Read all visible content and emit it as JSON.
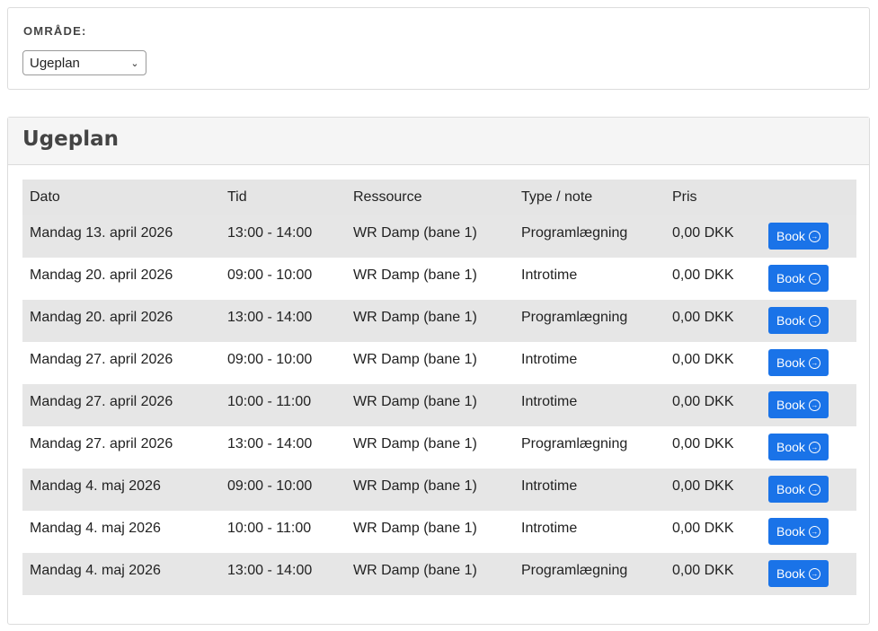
{
  "filter": {
    "label": "OMRÅDE:",
    "selected": "Ugeplan"
  },
  "schedule": {
    "title": "Ugeplan",
    "columns": [
      "Dato",
      "Tid",
      "Ressource",
      "Type / note",
      "Pris",
      ""
    ],
    "book_label": "Book",
    "rows": [
      {
        "date": "Mandag 13. april 2026",
        "time": "13:00 - 14:00",
        "resource": "WR Damp (bane 1)",
        "type": "Programlægning",
        "price": "0,00 DKK"
      },
      {
        "date": "Mandag 20. april 2026",
        "time": "09:00 - 10:00",
        "resource": "WR Damp (bane 1)",
        "type": "Introtime",
        "price": "0,00 DKK"
      },
      {
        "date": "Mandag 20. april 2026",
        "time": "13:00 - 14:00",
        "resource": "WR Damp (bane 1)",
        "type": "Programlægning",
        "price": "0,00 DKK"
      },
      {
        "date": "Mandag 27. april 2026",
        "time": "09:00 - 10:00",
        "resource": "WR Damp (bane 1)",
        "type": "Introtime",
        "price": "0,00 DKK"
      },
      {
        "date": "Mandag 27. april 2026",
        "time": "10:00 - 11:00",
        "resource": "WR Damp (bane 1)",
        "type": "Introtime",
        "price": "0,00 DKK"
      },
      {
        "date": "Mandag 27. april 2026",
        "time": "13:00 - 14:00",
        "resource": "WR Damp (bane 1)",
        "type": "Programlægning",
        "price": "0,00 DKK"
      },
      {
        "date": "Mandag 4. maj 2026",
        "time": "09:00 - 10:00",
        "resource": "WR Damp (bane 1)",
        "type": "Introtime",
        "price": "0,00 DKK"
      },
      {
        "date": "Mandag 4. maj 2026",
        "time": "10:00 - 11:00",
        "resource": "WR Damp (bane 1)",
        "type": "Introtime",
        "price": "0,00 DKK"
      },
      {
        "date": "Mandag 4. maj 2026",
        "time": "13:00 - 14:00",
        "resource": "WR Damp (bane 1)",
        "type": "Programlægning",
        "price": "0,00 DKK"
      }
    ]
  }
}
